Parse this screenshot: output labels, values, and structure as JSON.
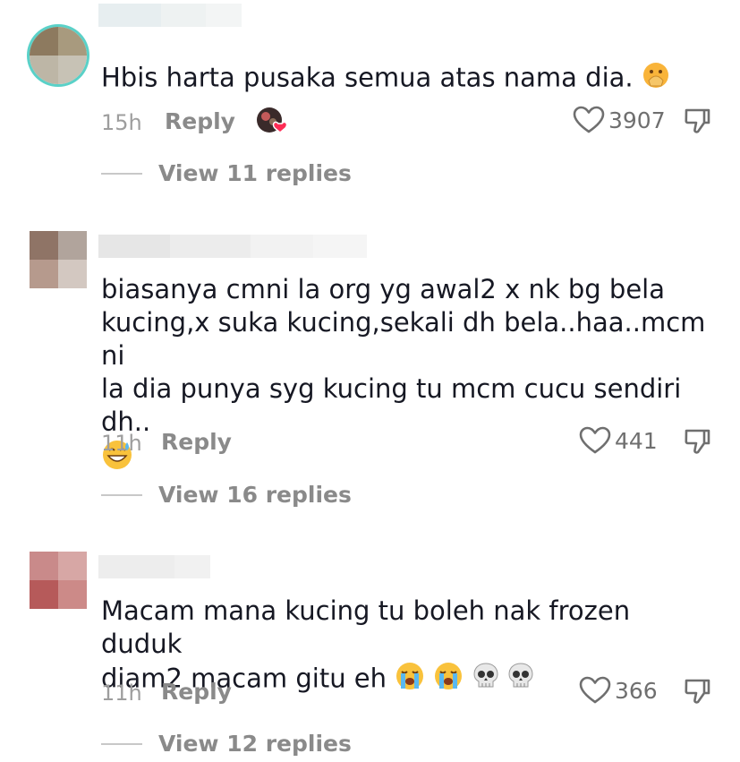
{
  "comments": [
    {
      "text": "Hbis harta pusaka semua atas nama dia.",
      "time": "15h",
      "reply_label": "Reply",
      "likes": "3907",
      "view_replies": "View 11 replies",
      "emojis": [
        "hand-over-mouth-emoji"
      ]
    },
    {
      "text_lines": [
        "biasanya cmni la org yg awal2 x nk bg bela",
        "kucing,x suka kucing,sekali dh bela..haa..mcm ni",
        "la dia punya syg kucing tu mcm cucu sendiri dh.."
      ],
      "time": "11h",
      "reply_label": "Reply",
      "likes": "441",
      "view_replies": "View 16 replies",
      "emojis": [
        "grinning-sweat-emoji"
      ]
    },
    {
      "text_lines": [
        "Macam mana kucing tu boleh nak frozen duduk",
        "diam2 macam gitu eh"
      ],
      "time": "11h",
      "reply_label": "Reply",
      "likes": "366",
      "view_replies": "View 12 replies",
      "emojis": [
        "loudly-crying-emoji",
        "loudly-crying-emoji",
        "skull-emoji",
        "skull-emoji"
      ]
    }
  ],
  "icons": {
    "like": "heart-outline-icon",
    "dislike": "thumbs-down-outline-icon",
    "creator_liked": "creator-liked-avatar-icon"
  },
  "colors": {
    "text": "#161823",
    "secondary": "#8a8a8a",
    "liked_heart": "#fe2c55"
  }
}
